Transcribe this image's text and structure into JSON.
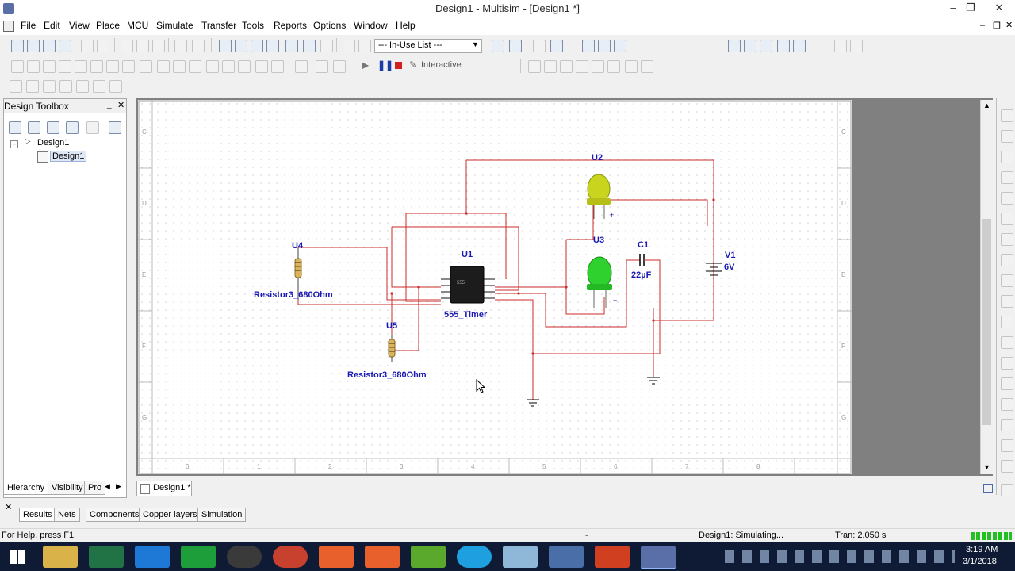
{
  "window": {
    "title": "Design1 - Multisim - [Design1 *]"
  },
  "menu": [
    "File",
    "Edit",
    "View",
    "Place",
    "MCU",
    "Simulate",
    "Transfer",
    "Tools",
    "Reports",
    "Options",
    "Window",
    "Help"
  ],
  "toolbar": {
    "in_use_list": "--- In-Use List ---",
    "interactive": "Interactive"
  },
  "design_toolbox": {
    "title": "Design Toolbox",
    "root": "Design1",
    "child": "Design1",
    "tabs": [
      "Hierarchy",
      "Visibility",
      "Pro"
    ]
  },
  "document_tab": "Design1 *",
  "schematic": {
    "components": {
      "u4_ref": "U4",
      "u4_value": "Resistor3_680Ohm",
      "u5_ref": "U5",
      "u5_value": "Resistor3_680Ohm",
      "u1_ref": "U1",
      "u1_value": "555_Timer",
      "u2_ref": "U2",
      "u3_ref": "U3",
      "c1_ref": "C1",
      "c1_value": "22µF",
      "v1_ref": "V1",
      "v1_value": "6V"
    },
    "led_u2_color": "#c8d41e",
    "led_u3_color": "#2fd12f",
    "wire_color": "#cc2b2b"
  },
  "bottom_tabs": [
    "Results",
    "Nets",
    "Components",
    "Copper layers",
    "Simulation"
  ],
  "status": {
    "help": "For Help, press F1",
    "dash": "-",
    "state": "Design1: Simulating...",
    "tran": "Tran: 2.050 s"
  },
  "clock": {
    "time": "3:19 AM",
    "date": "3/1/2018"
  }
}
